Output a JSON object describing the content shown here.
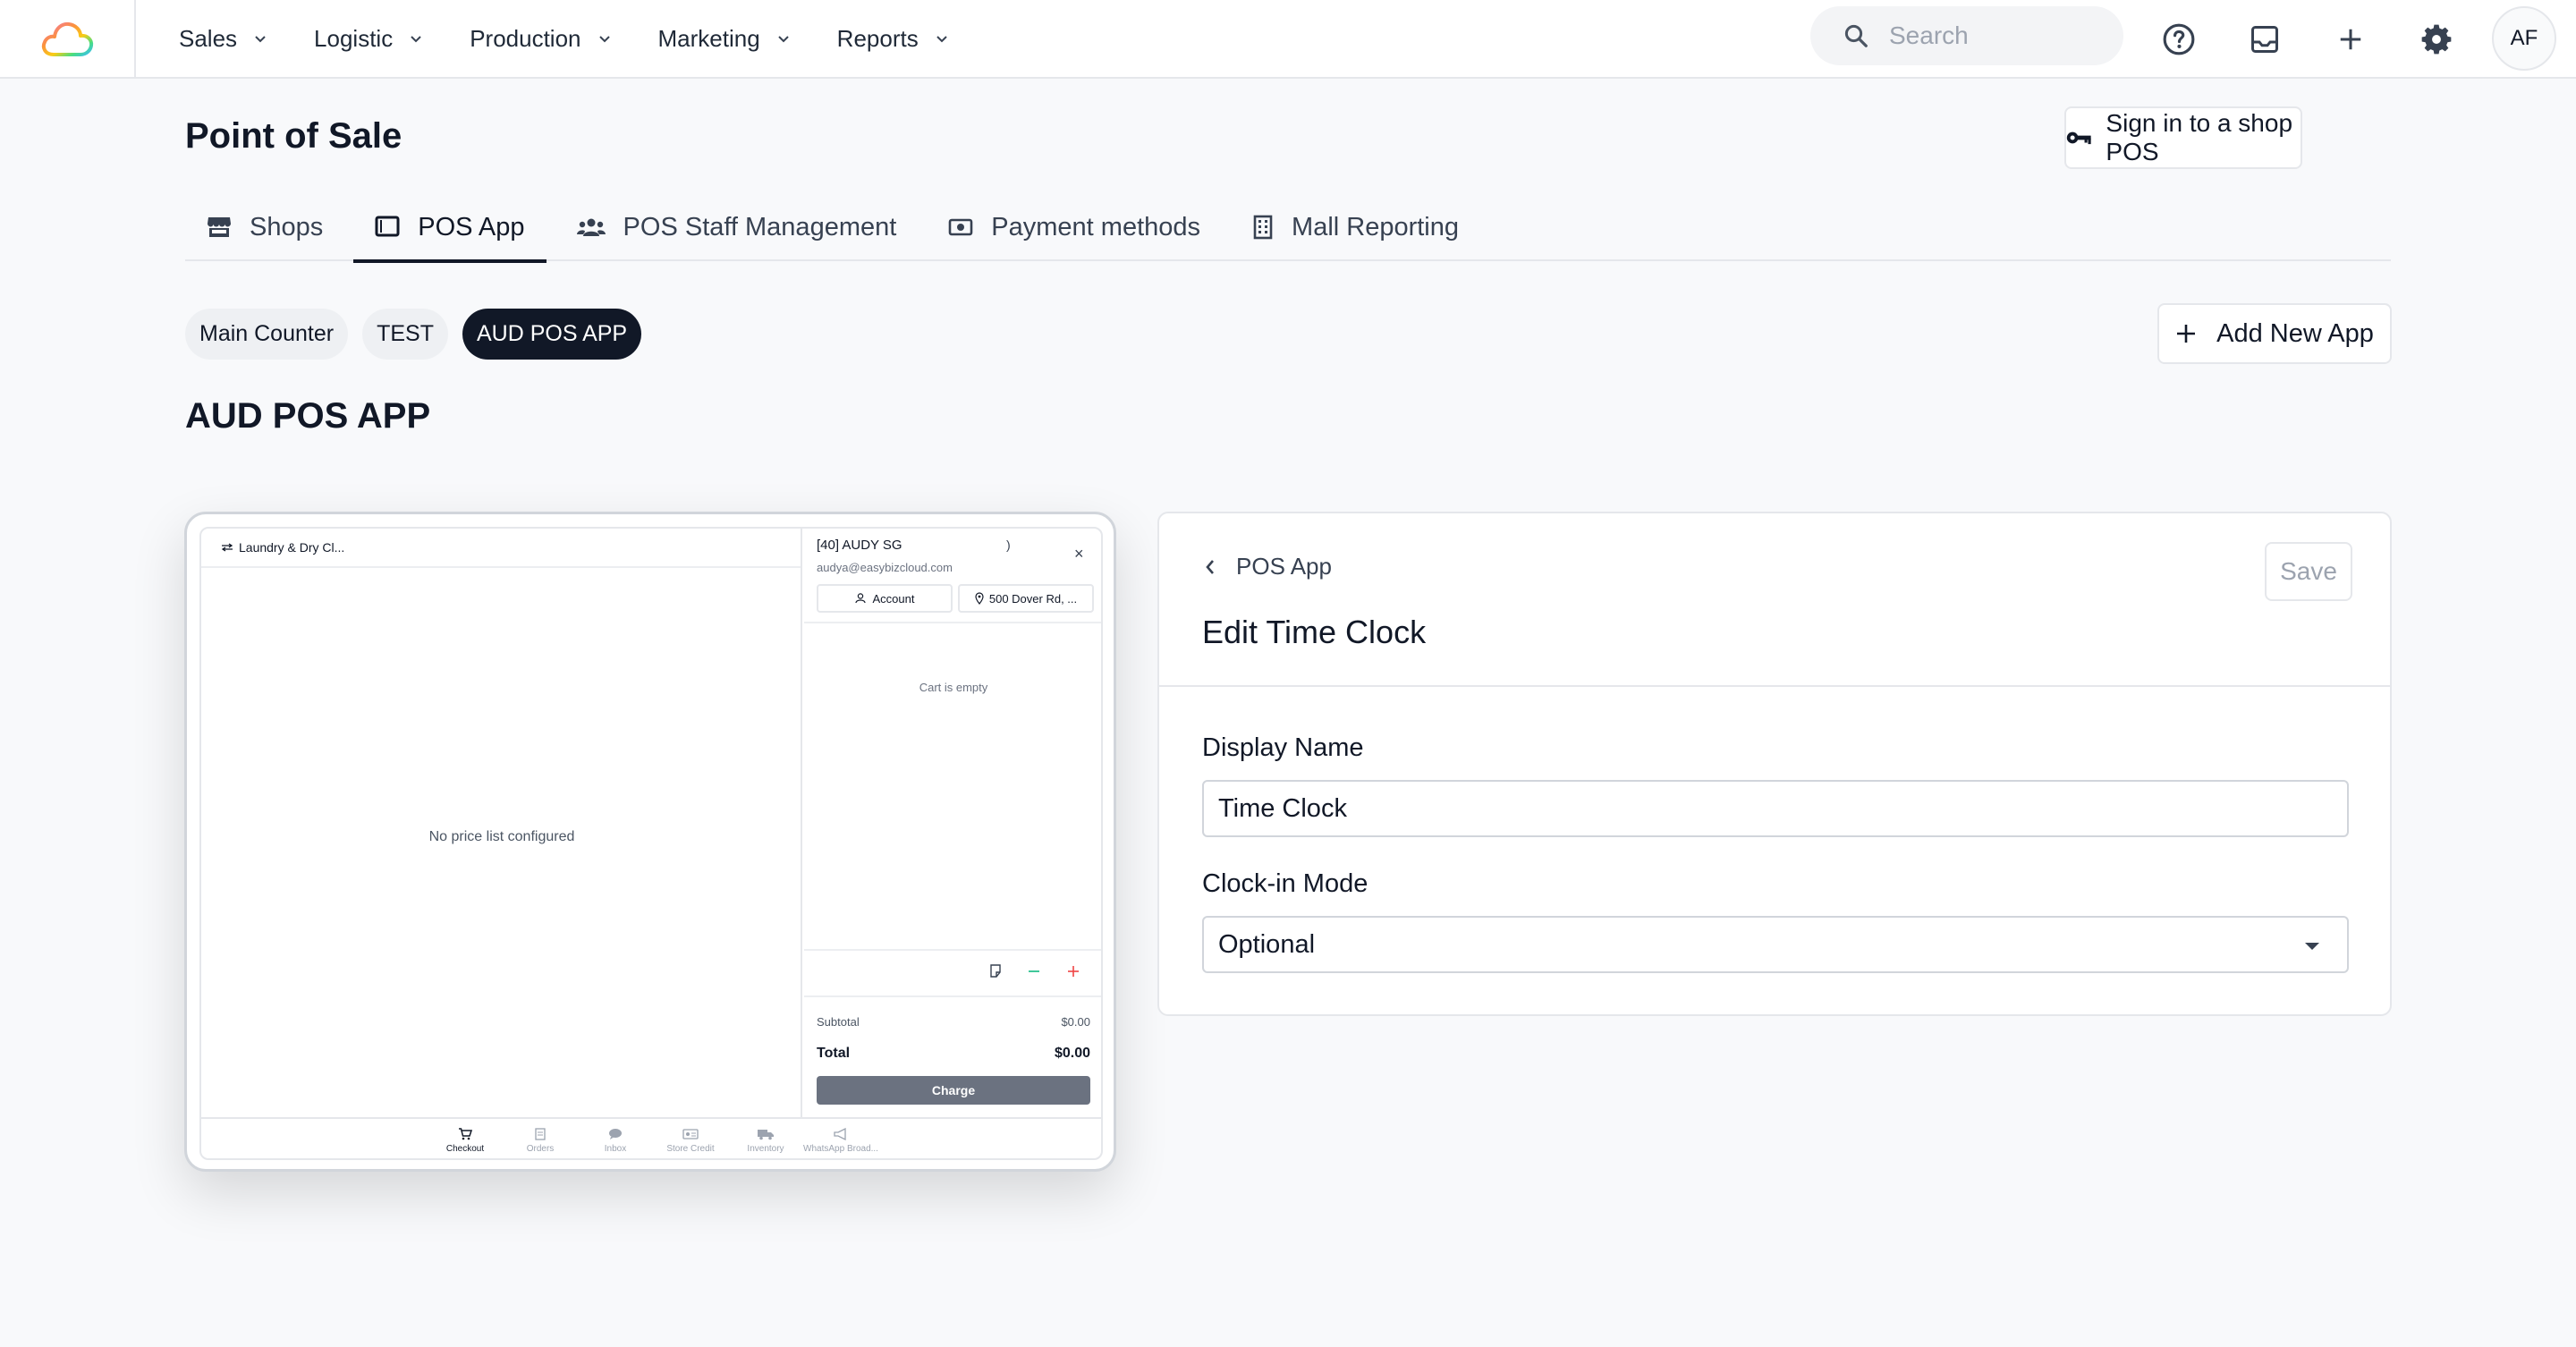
{
  "nav": {
    "menus": [
      "Sales",
      "Logistic",
      "Production",
      "Marketing",
      "Reports"
    ],
    "search_placeholder": "Search",
    "avatar_initials": "AF"
  },
  "page": {
    "title": "Point of Sale",
    "signin_label": "Sign in to a shop POS"
  },
  "tabs": [
    {
      "label": "Shops",
      "icon": "store-icon"
    },
    {
      "label": "POS App",
      "icon": "tablet-icon",
      "active": true
    },
    {
      "label": "POS Staff Management",
      "icon": "users-icon"
    },
    {
      "label": "Payment methods",
      "icon": "cash-icon"
    },
    {
      "label": "Mall Reporting",
      "icon": "building-icon"
    }
  ],
  "apps": {
    "chips": [
      "Main Counter",
      "TEST",
      "AUD POS APP"
    ],
    "active": "AUD POS APP",
    "add_label": "Add New App"
  },
  "section_title": "AUD POS APP",
  "preview": {
    "shop_selector": "Laundry & Dry Cl...",
    "no_price_list": "No price list configured",
    "customer_name": "[40] AUDY SG",
    "customer_email": "audya@easybizcloud.com",
    "caret": ")",
    "close": "×",
    "account_label": "Account",
    "address_label": "500 Dover Rd, ...",
    "cart_empty": "Cart is empty",
    "subtotal_label": "Subtotal",
    "subtotal_value": "$0.00",
    "total_label": "Total",
    "total_value": "$0.00",
    "charge_label": "Charge",
    "bottom_tabs": [
      "Checkout",
      "Orders",
      "Inbox",
      "Store Credit",
      "Inventory",
      "WhatsApp Broad..."
    ]
  },
  "edit": {
    "back_label": "POS App",
    "title": "Edit Time Clock",
    "save_label": "Save",
    "display_name_label": "Display Name",
    "display_name_value": "Time Clock",
    "clockin_label": "Clock-in Mode",
    "clockin_value": "Optional"
  },
  "colors": {
    "primary": "#111827",
    "border": "#e5e7eb",
    "background": "#f8f9fb",
    "minus_green": "#10b981",
    "plus_red": "#ef4444"
  }
}
